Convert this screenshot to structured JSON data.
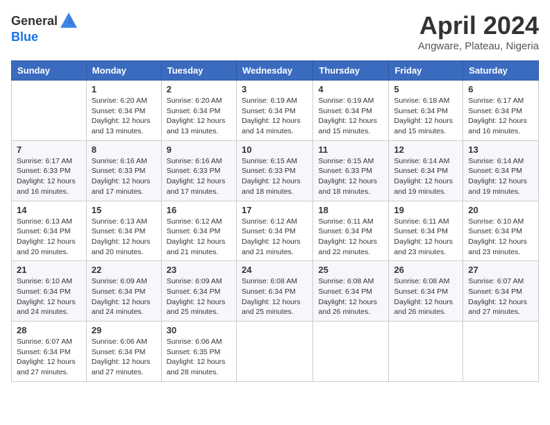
{
  "header": {
    "logo_general": "General",
    "logo_blue": "Blue",
    "title": "April 2024",
    "subtitle": "Angware, Plateau, Nigeria"
  },
  "weekdays": [
    "Sunday",
    "Monday",
    "Tuesday",
    "Wednesday",
    "Thursday",
    "Friday",
    "Saturday"
  ],
  "weeks": [
    [
      {
        "day": "",
        "info": ""
      },
      {
        "day": "1",
        "info": "Sunrise: 6:20 AM\nSunset: 6:34 PM\nDaylight: 12 hours\nand 13 minutes."
      },
      {
        "day": "2",
        "info": "Sunrise: 6:20 AM\nSunset: 6:34 PM\nDaylight: 12 hours\nand 13 minutes."
      },
      {
        "day": "3",
        "info": "Sunrise: 6:19 AM\nSunset: 6:34 PM\nDaylight: 12 hours\nand 14 minutes."
      },
      {
        "day": "4",
        "info": "Sunrise: 6:19 AM\nSunset: 6:34 PM\nDaylight: 12 hours\nand 15 minutes."
      },
      {
        "day": "5",
        "info": "Sunrise: 6:18 AM\nSunset: 6:34 PM\nDaylight: 12 hours\nand 15 minutes."
      },
      {
        "day": "6",
        "info": "Sunrise: 6:17 AM\nSunset: 6:34 PM\nDaylight: 12 hours\nand 16 minutes."
      }
    ],
    [
      {
        "day": "7",
        "info": "Sunrise: 6:17 AM\nSunset: 6:33 PM\nDaylight: 12 hours\nand 16 minutes."
      },
      {
        "day": "8",
        "info": "Sunrise: 6:16 AM\nSunset: 6:33 PM\nDaylight: 12 hours\nand 17 minutes."
      },
      {
        "day": "9",
        "info": "Sunrise: 6:16 AM\nSunset: 6:33 PM\nDaylight: 12 hours\nand 17 minutes."
      },
      {
        "day": "10",
        "info": "Sunrise: 6:15 AM\nSunset: 6:33 PM\nDaylight: 12 hours\nand 18 minutes."
      },
      {
        "day": "11",
        "info": "Sunrise: 6:15 AM\nSunset: 6:33 PM\nDaylight: 12 hours\nand 18 minutes."
      },
      {
        "day": "12",
        "info": "Sunrise: 6:14 AM\nSunset: 6:34 PM\nDaylight: 12 hours\nand 19 minutes."
      },
      {
        "day": "13",
        "info": "Sunrise: 6:14 AM\nSunset: 6:34 PM\nDaylight: 12 hours\nand 19 minutes."
      }
    ],
    [
      {
        "day": "14",
        "info": "Sunrise: 6:13 AM\nSunset: 6:34 PM\nDaylight: 12 hours\nand 20 minutes."
      },
      {
        "day": "15",
        "info": "Sunrise: 6:13 AM\nSunset: 6:34 PM\nDaylight: 12 hours\nand 20 minutes."
      },
      {
        "day": "16",
        "info": "Sunrise: 6:12 AM\nSunset: 6:34 PM\nDaylight: 12 hours\nand 21 minutes."
      },
      {
        "day": "17",
        "info": "Sunrise: 6:12 AM\nSunset: 6:34 PM\nDaylight: 12 hours\nand 21 minutes."
      },
      {
        "day": "18",
        "info": "Sunrise: 6:11 AM\nSunset: 6:34 PM\nDaylight: 12 hours\nand 22 minutes."
      },
      {
        "day": "19",
        "info": "Sunrise: 6:11 AM\nSunset: 6:34 PM\nDaylight: 12 hours\nand 23 minutes."
      },
      {
        "day": "20",
        "info": "Sunrise: 6:10 AM\nSunset: 6:34 PM\nDaylight: 12 hours\nand 23 minutes."
      }
    ],
    [
      {
        "day": "21",
        "info": "Sunrise: 6:10 AM\nSunset: 6:34 PM\nDaylight: 12 hours\nand 24 minutes."
      },
      {
        "day": "22",
        "info": "Sunrise: 6:09 AM\nSunset: 6:34 PM\nDaylight: 12 hours\nand 24 minutes."
      },
      {
        "day": "23",
        "info": "Sunrise: 6:09 AM\nSunset: 6:34 PM\nDaylight: 12 hours\nand 25 minutes."
      },
      {
        "day": "24",
        "info": "Sunrise: 6:08 AM\nSunset: 6:34 PM\nDaylight: 12 hours\nand 25 minutes."
      },
      {
        "day": "25",
        "info": "Sunrise: 6:08 AM\nSunset: 6:34 PM\nDaylight: 12 hours\nand 26 minutes."
      },
      {
        "day": "26",
        "info": "Sunrise: 6:08 AM\nSunset: 6:34 PM\nDaylight: 12 hours\nand 26 minutes."
      },
      {
        "day": "27",
        "info": "Sunrise: 6:07 AM\nSunset: 6:34 PM\nDaylight: 12 hours\nand 27 minutes."
      }
    ],
    [
      {
        "day": "28",
        "info": "Sunrise: 6:07 AM\nSunset: 6:34 PM\nDaylight: 12 hours\nand 27 minutes."
      },
      {
        "day": "29",
        "info": "Sunrise: 6:06 AM\nSunset: 6:34 PM\nDaylight: 12 hours\nand 27 minutes."
      },
      {
        "day": "30",
        "info": "Sunrise: 6:06 AM\nSunset: 6:35 PM\nDaylight: 12 hours\nand 28 minutes."
      },
      {
        "day": "",
        "info": ""
      },
      {
        "day": "",
        "info": ""
      },
      {
        "day": "",
        "info": ""
      },
      {
        "day": "",
        "info": ""
      }
    ]
  ]
}
